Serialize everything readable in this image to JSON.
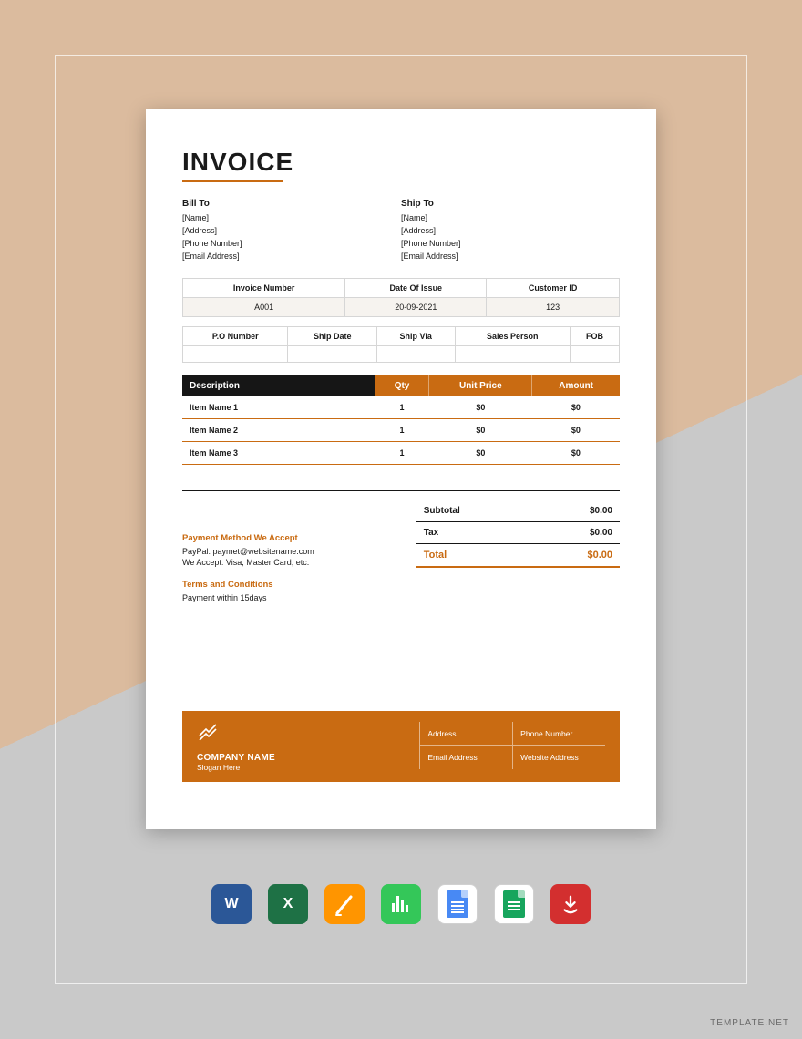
{
  "title": "INVOICE",
  "billto": {
    "label": "Bill To",
    "name": "[Name]",
    "address": "[Address]",
    "phone": "[Phone Number]",
    "email": "[Email Address]"
  },
  "shipto": {
    "label": "Ship To",
    "name": "[Name]",
    "address": "[Address]",
    "phone": "[Phone Number]",
    "email": "[Email Address]"
  },
  "meta": {
    "h1": "Invoice Number",
    "h2": "Date Of Issue",
    "h3": "Customer ID",
    "v1": "A001",
    "v2": "20-09-2021",
    "v3": "123"
  },
  "meta2": {
    "h1": "P.O Number",
    "h2": "Ship Date",
    "h3": "Ship Via",
    "h4": "Sales Person",
    "h5": "FOB"
  },
  "itemhead": {
    "desc": "Description",
    "qty": "Qty",
    "unit": "Unit Price",
    "amt": "Amount"
  },
  "items": [
    {
      "d": "Item Name 1",
      "q": "1",
      "u": "$0",
      "a": "$0"
    },
    {
      "d": "Item Name 2",
      "q": "1",
      "u": "$0",
      "a": "$0"
    },
    {
      "d": "Item Name 3",
      "q": "1",
      "u": "$0",
      "a": "$0"
    }
  ],
  "totals": {
    "subtotal_l": "Subtotal",
    "subtotal_v": "$0.00",
    "tax_l": "Tax",
    "tax_v": "$0.00",
    "total_l": "Total",
    "total_v": "$0.00"
  },
  "payment": {
    "h": "Payment Method We Accept",
    "l1": "PayPal: paymet@websitename.com",
    "l2": "We Accept: Visa, Master Card, etc."
  },
  "terms": {
    "h": "Terms and Conditions",
    "t": "Payment within 15days"
  },
  "footer": {
    "co": "COMPANY NAME",
    "slogan": "Slogan Here",
    "c1": "Address",
    "c2": "Phone Number",
    "c3": "Email Address",
    "c4": "Website Address"
  },
  "appicons": {
    "word": "W",
    "excel": "X",
    "pdf_glyph": "⤓"
  },
  "watermark": "TEMPLATE.NET"
}
